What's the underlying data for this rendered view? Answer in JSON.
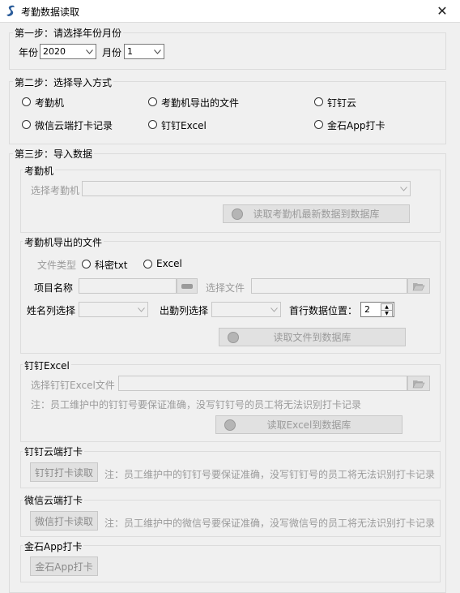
{
  "window": {
    "title": "考勤数据读取",
    "close_icon": "close-icon"
  },
  "step1": {
    "legend": "第一步：请选择年份月份",
    "year_label": "年份",
    "year_value": "2020",
    "month_label": "月份",
    "month_value": "1"
  },
  "step2": {
    "legend": "第二步：选择导入方式",
    "options": [
      "考勤机",
      "考勤机导出的文件",
      "钉钉云",
      "微信云端打卡记录",
      "钉钉Excel",
      "金石App打卡"
    ]
  },
  "step3": {
    "legend": "第三步：导入数据",
    "machine": {
      "legend": "考勤机",
      "select_label": "选择考勤机",
      "select_value": "",
      "read_button": "读取考勤机最新数据到数据库"
    },
    "file": {
      "legend": "考勤机导出的文件",
      "type_label": "文件类型",
      "type_options": [
        "科密txt",
        "Excel"
      ],
      "project_label": "项目名称",
      "select_file_label": "选择文件",
      "name_col_label": "姓名列选择",
      "attend_col_label": "出勤列选择",
      "first_row_label": "首行数据位置：",
      "first_row_value": "2",
      "read_button": "读取文件到数据库"
    },
    "dingding_excel": {
      "legend": "钉钉Excel",
      "select_label": "选择钉钉Excel文件",
      "note": "注：员工维护中的钉钉号要保证准确，没写钉钉号的员工将无法识别打卡记录",
      "read_button": "读取Excel到数据库"
    },
    "dingding_cloud": {
      "legend": "钉钉云端打卡",
      "button": "钉钉打卡读取",
      "note": "注：员工维护中的钉钉号要保证准确，没写钉钉号的员工将无法识别打卡记录"
    },
    "wechat_cloud": {
      "legend": "微信云端打卡",
      "button": "微信打卡读取",
      "note": "注：员工维护中的微信号要保证准确，没写微信号的员工将无法识别打卡记录"
    },
    "jinshi": {
      "legend": "金石App打卡",
      "button": "金石App打卡"
    }
  }
}
